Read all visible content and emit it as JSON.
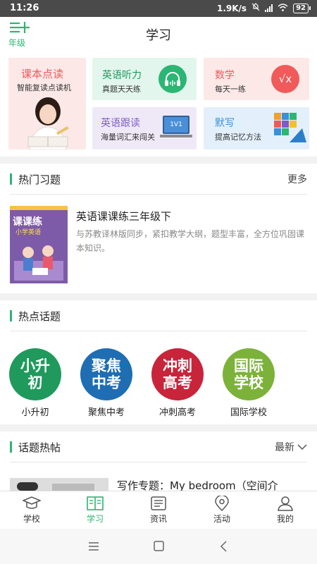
{
  "status_bar": {
    "time": "11:26",
    "network_speed": "1.9K/s",
    "battery": "92"
  },
  "header": {
    "grade_label": "年级",
    "title": "学习"
  },
  "features": [
    {
      "title": "课本点读",
      "subtitle": "智能复读点读机"
    },
    {
      "title": "英语听力",
      "subtitle": "真题天天练"
    },
    {
      "title": "数学",
      "subtitle": "每天一练",
      "icon_text": "√x"
    },
    {
      "title": "英语跟读",
      "subtitle": "海量词汇来闯关",
      "icon_text": "1V1"
    },
    {
      "title": "默写",
      "subtitle": "提高记忆方法"
    }
  ],
  "hot_exercises": {
    "heading": "热门习题",
    "more": "更多",
    "book": {
      "cover_title": "课课练",
      "cover_subtitle": "小学英语",
      "title": "英语课课练三年级下",
      "description": "与苏教译林版同步，紧扣教学大纲，题型丰富，全方位巩固课本知识。"
    }
  },
  "hot_topics": {
    "heading": "热点话题",
    "items": [
      {
        "badge_line1": "小升",
        "badge_line2": "初",
        "label": "小升初",
        "color": "#1f9a5c"
      },
      {
        "badge_line1": "聚焦",
        "badge_line2": "中考",
        "label": "聚焦中考",
        "color": "#1f6db3"
      },
      {
        "badge_line1": "冲刺",
        "badge_line2": "高考",
        "label": "冲刺高考",
        "color": "#c8243a"
      },
      {
        "badge_line1": "国际",
        "badge_line2": "学校",
        "label": "国际学校",
        "color": "#7cb23a"
      }
    ]
  },
  "topic_posts": {
    "heading": "话题热帖",
    "sort_label": "最新",
    "first_post_title": "写作专题：My bedroom（空间介"
  },
  "tabs": [
    {
      "label": "学校",
      "icon": "graduation-cap-icon"
    },
    {
      "label": "学习",
      "icon": "book-icon",
      "active": true
    },
    {
      "label": "资讯",
      "icon": "news-icon"
    },
    {
      "label": "活动",
      "icon": "location-pin-icon"
    },
    {
      "label": "我的",
      "icon": "user-icon"
    }
  ],
  "colors": {
    "accent": "#2bb673",
    "statusbar": "#4a4a4a"
  }
}
